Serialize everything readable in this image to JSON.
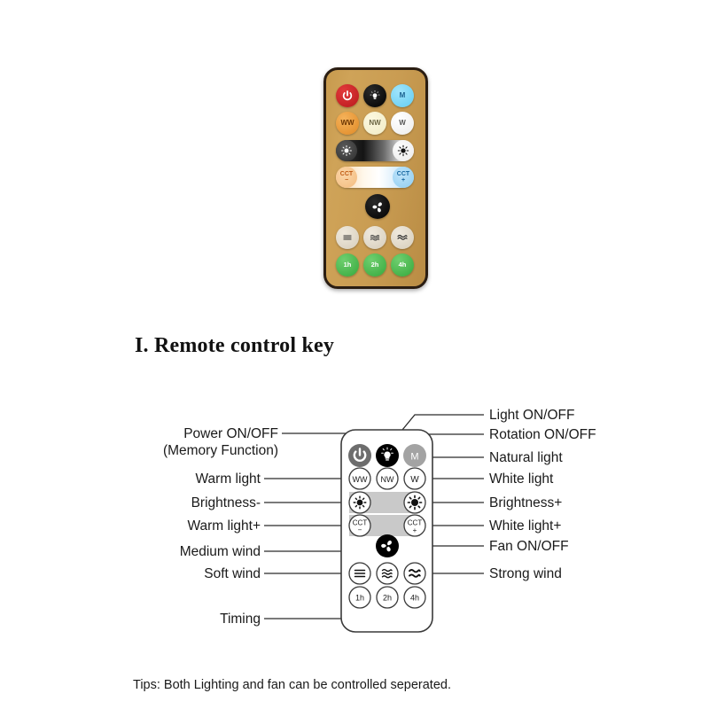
{
  "page_title": "I. Remote control key",
  "tips": "Tips: Both Lighting and fan can be controlled seperated.",
  "photo": {
    "alt_name": "remote-control-photo",
    "body_color": "#c79a4e",
    "border_color": "#2a1d12",
    "buttons": {
      "power": {
        "label": "",
        "icon": "power-icon",
        "color": "#c8202a"
      },
      "light": {
        "label": "",
        "icon": "bulb-icon",
        "color": "#000000"
      },
      "memory": {
        "label": "M",
        "color": "#63cdf2"
      },
      "warm_white": {
        "label": "WW",
        "color": "#e08a26"
      },
      "natural_white": {
        "label": "NW",
        "color": "#f0ebc6"
      },
      "white": {
        "label": "W",
        "color": "#ffffff"
      },
      "brightness_down": {
        "label": "",
        "icon": "brightness-low-icon"
      },
      "brightness_up": {
        "label": "",
        "icon": "brightness-high-icon"
      },
      "cct_down": {
        "label": "CCT",
        "sub": "−",
        "color": "#f3bb7e"
      },
      "cct_up": {
        "label": "CCT",
        "sub": "+",
        "color": "#8fcdf0"
      },
      "fan": {
        "label": "",
        "icon": "fan-icon",
        "color": "#000000"
      },
      "wind_soft": {
        "label": "",
        "icon": "wind-soft-icon",
        "color": "#d6cdbb"
      },
      "wind_medium": {
        "label": "",
        "icon": "wind-medium-icon",
        "color": "#d6cdbb"
      },
      "wind_strong": {
        "label": "",
        "icon": "wind-strong-icon",
        "color": "#d6cdbb"
      },
      "timer_1h": {
        "label": "1h",
        "color": "#35a83c"
      },
      "timer_2h": {
        "label": "2h",
        "color": "#35a83c"
      },
      "timer_4h": {
        "label": "4h",
        "color": "#35a83c"
      }
    }
  },
  "diagram": {
    "button_labels": {
      "memory": "M",
      "warm_white": "WW",
      "natural_white": "NW",
      "white": "W",
      "cct_minus_top": "CCT",
      "cct_minus_bottom": "−",
      "cct_plus_top": "CCT",
      "cct_plus_bottom": "+",
      "timer_1h": "1h",
      "timer_2h": "2h",
      "timer_4h": "4h"
    },
    "callouts_left": [
      {
        "id": "power",
        "line1": "Power ON/OFF",
        "line2": "(Memory Function)"
      },
      {
        "id": "warm-light",
        "line1": "Warm light"
      },
      {
        "id": "brightness-down",
        "line1": "Brightness-"
      },
      {
        "id": "warm-light-plus",
        "line1": "Warm light+"
      },
      {
        "id": "medium-wind",
        "line1": "Medium wind"
      },
      {
        "id": "soft-wind",
        "line1": "Soft wind"
      },
      {
        "id": "timing",
        "line1": "Timing"
      }
    ],
    "callouts_right": [
      {
        "id": "light-onoff",
        "line1": "Light ON/OFF"
      },
      {
        "id": "rotation-onoff",
        "line1": "Rotation ON/OFF"
      },
      {
        "id": "natural-light",
        "line1": "Natural light"
      },
      {
        "id": "white-light",
        "line1": "White light"
      },
      {
        "id": "brightness-up",
        "line1": "Brightness+"
      },
      {
        "id": "white-light-plus",
        "line1": "White light+"
      },
      {
        "id": "fan-onoff",
        "line1": "Fan ON/OFF"
      },
      {
        "id": "strong-wind",
        "line1": "Strong wind"
      }
    ]
  }
}
